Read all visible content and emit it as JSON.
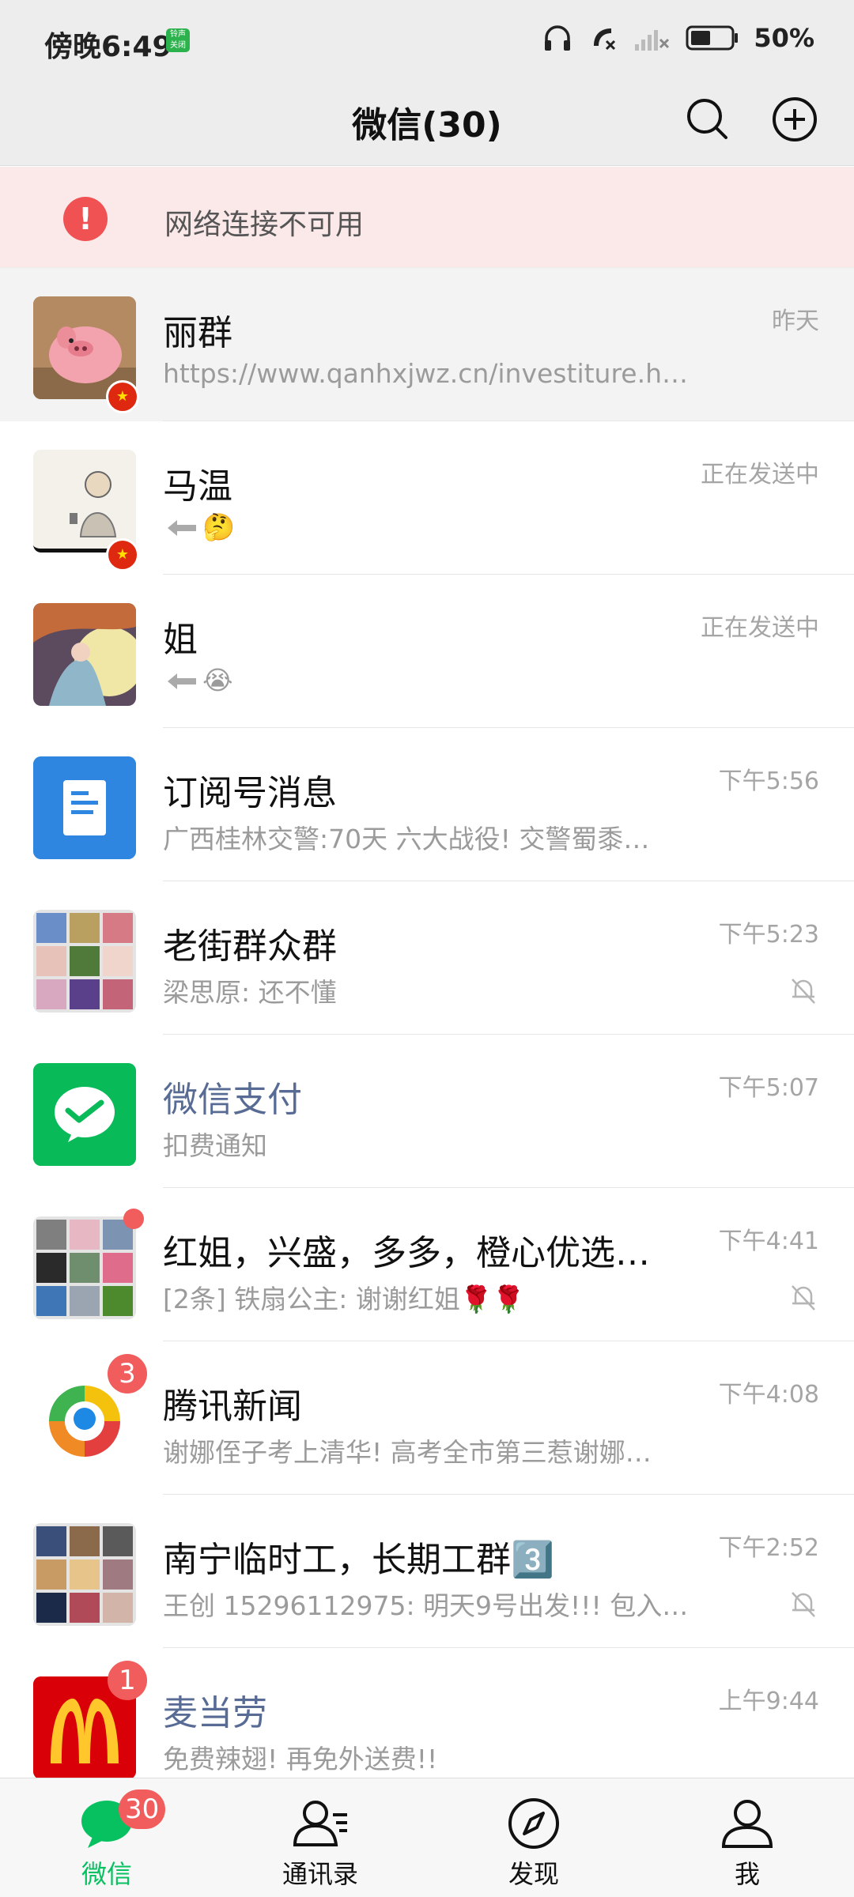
{
  "status_bar": {
    "time": "傍晚6:49",
    "chip_text": "铃声\n关闭",
    "battery": "50%",
    "icons": [
      "headphones-icon",
      "call-muted-icon",
      "no-signal-icon",
      "battery-icon"
    ]
  },
  "header": {
    "title": "微信(30)",
    "icons": [
      "search-icon",
      "add-circle-icon"
    ]
  },
  "banner": {
    "icon": "!",
    "text": "网络连接不可用"
  },
  "chats": [
    {
      "name": "丽群",
      "preview": "https://www.qanhxjwz.cn/investiture.h…",
      "time": "昨天",
      "pinned": true
    },
    {
      "name": "马温",
      "preview": "🤔",
      "time": "正在发送中",
      "sending": true
    },
    {
      "name": "姐",
      "preview": "😭",
      "time": "正在发送中",
      "sending": true
    },
    {
      "name": "订阅号消息",
      "preview": "广西桂林交警:70天 六大战役! 交警蜀黍…",
      "time": "下午5:56"
    },
    {
      "name": "老街群众群",
      "preview": "梁思原: 还不懂",
      "time": "下午5:23",
      "muted": true
    },
    {
      "name": "微信支付",
      "preview": "扣费通知",
      "time": "下午5:07",
      "service": true
    },
    {
      "name": "红姐，兴盛，多多，橙心优选…",
      "preview": "[2条] 铁扇公主: 谢谢红姐🌹🌹",
      "time": "下午4:41",
      "muted": true,
      "dot": true
    },
    {
      "name": "腾讯新闻",
      "preview": "谢娜侄子考上清华! 高考全市第三惹谢娜…",
      "time": "下午4:08",
      "badge": "3"
    },
    {
      "name": "南宁临时工，长期工群3️⃣",
      "preview": "王创 15296112975: 明天9号出发!!! 包入…",
      "time": "下午2:52",
      "muted": true
    },
    {
      "name": "麦当劳",
      "preview": "免费辣翅! 再免外送费!!",
      "time": "上午9:44",
      "service": true,
      "badge": "1"
    }
  ],
  "bottom_nav": [
    {
      "label": "微信",
      "icon": "chat-bubble-icon",
      "active": true,
      "badge": "30"
    },
    {
      "label": "通讯录",
      "icon": "contacts-icon"
    },
    {
      "label": "发现",
      "icon": "compass-icon"
    },
    {
      "label": "我",
      "icon": "profile-icon"
    }
  ],
  "colors": {
    "accent_green": "#07c160",
    "badge_red": "#f15c5c",
    "service_name": "#576b95",
    "banner_bg": "#fbe9ea"
  }
}
